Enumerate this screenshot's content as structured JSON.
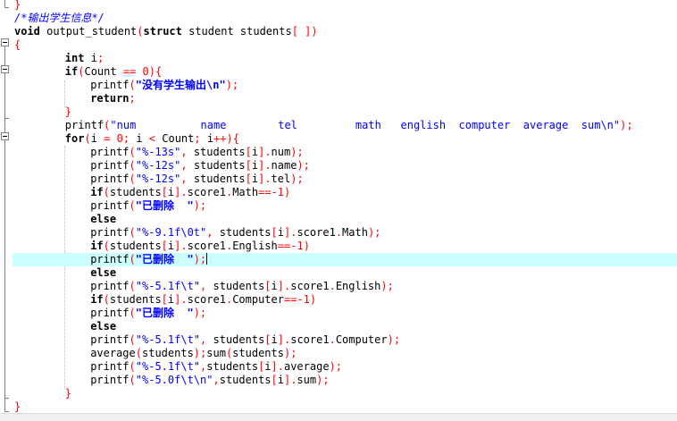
{
  "editor": {
    "colors": {
      "keyword": "#000000",
      "string": "#0000ff",
      "comment": "#0000ff",
      "operator": "#ff0000",
      "current_line": "#ccffff",
      "fold_marker": "#808080"
    },
    "current_line_index": 19,
    "lines": [
      {
        "indent": 0,
        "tokens": [
          {
            "t": "}",
            "k": "op"
          }
        ]
      },
      {
        "indent": 0,
        "tokens": [
          {
            "t": "/*输出学生信息*/",
            "k": "cmt"
          }
        ]
      },
      {
        "indent": 0,
        "tokens": [
          {
            "t": "void",
            "k": "kw"
          },
          {
            "t": " output_student",
            "k": "id"
          },
          {
            "t": "(",
            "k": "op"
          },
          {
            "t": "struct",
            "k": "kw"
          },
          {
            "t": " student students",
            "k": "id"
          },
          {
            "t": "[ ])",
            "k": "op"
          }
        ]
      },
      {
        "indent": 0,
        "tokens": [
          {
            "t": "{",
            "k": "op"
          }
        ]
      },
      {
        "indent": 4,
        "tokens": [
          {
            "t": "int",
            "k": "kw"
          },
          {
            "t": " i",
            "k": "id"
          },
          {
            "t": ";",
            "k": "op"
          }
        ]
      },
      {
        "indent": 4,
        "tokens": [
          {
            "t": "if",
            "k": "kw"
          },
          {
            "t": "(",
            "k": "op"
          },
          {
            "t": "Count ",
            "k": "id"
          },
          {
            "t": "==",
            "k": "op"
          },
          {
            "t": " ",
            "k": "id"
          },
          {
            "t": "0",
            "k": "num"
          },
          {
            "t": "){",
            "k": "op"
          }
        ]
      },
      {
        "indent": 6,
        "tokens": [
          {
            "t": "printf",
            "k": "id"
          },
          {
            "t": "(",
            "k": "op"
          },
          {
            "t": "\"没有学生输出\\n\"",
            "k": "strcn"
          },
          {
            "t": ");",
            "k": "op"
          }
        ]
      },
      {
        "indent": 6,
        "tokens": [
          {
            "t": "return",
            "k": "kw"
          },
          {
            "t": ";",
            "k": "op"
          }
        ]
      },
      {
        "indent": 4,
        "tokens": [
          {
            "t": "}",
            "k": "op"
          }
        ]
      },
      {
        "indent": 4,
        "tokens": [
          {
            "t": "printf",
            "k": "id"
          },
          {
            "t": "(",
            "k": "op"
          },
          {
            "t": "\"num          name        tel         math   english  computer  average  sum\\n\"",
            "k": "str"
          },
          {
            "t": ");",
            "k": "op"
          }
        ]
      },
      {
        "indent": 4,
        "tokens": [
          {
            "t": "for",
            "k": "kw"
          },
          {
            "t": "(",
            "k": "op"
          },
          {
            "t": "i ",
            "k": "id"
          },
          {
            "t": "=",
            "k": "op"
          },
          {
            "t": " ",
            "k": "id"
          },
          {
            "t": "0",
            "k": "num"
          },
          {
            "t": ";",
            "k": "op"
          },
          {
            "t": " i ",
            "k": "id"
          },
          {
            "t": "<",
            "k": "op"
          },
          {
            "t": " Count",
            "k": "id"
          },
          {
            "t": ";",
            "k": "op"
          },
          {
            "t": " i",
            "k": "id"
          },
          {
            "t": "++){",
            "k": "op"
          }
        ]
      },
      {
        "indent": 6,
        "tokens": [
          {
            "t": "printf",
            "k": "id"
          },
          {
            "t": "(",
            "k": "op"
          },
          {
            "t": "\"%-13s\"",
            "k": "str"
          },
          {
            "t": ",",
            "k": "op"
          },
          {
            "t": " students",
            "k": "id"
          },
          {
            "t": "[",
            "k": "op"
          },
          {
            "t": "i",
            "k": "id"
          },
          {
            "t": "].",
            "k": "op"
          },
          {
            "t": "num",
            "k": "id"
          },
          {
            "t": ");",
            "k": "op"
          }
        ]
      },
      {
        "indent": 6,
        "tokens": [
          {
            "t": "printf",
            "k": "id"
          },
          {
            "t": "(",
            "k": "op"
          },
          {
            "t": "\"%-12s\"",
            "k": "str"
          },
          {
            "t": ",",
            "k": "op"
          },
          {
            "t": " students",
            "k": "id"
          },
          {
            "t": "[",
            "k": "op"
          },
          {
            "t": "i",
            "k": "id"
          },
          {
            "t": "].",
            "k": "op"
          },
          {
            "t": "name",
            "k": "id"
          },
          {
            "t": ");",
            "k": "op"
          }
        ]
      },
      {
        "indent": 6,
        "tokens": [
          {
            "t": "printf",
            "k": "id"
          },
          {
            "t": "(",
            "k": "op"
          },
          {
            "t": "\"%-12s\"",
            "k": "str"
          },
          {
            "t": ",",
            "k": "op"
          },
          {
            "t": " students",
            "k": "id"
          },
          {
            "t": "[",
            "k": "op"
          },
          {
            "t": "i",
            "k": "id"
          },
          {
            "t": "].",
            "k": "op"
          },
          {
            "t": "tel",
            "k": "id"
          },
          {
            "t": ");",
            "k": "op"
          }
        ]
      },
      {
        "indent": 6,
        "tokens": [
          {
            "t": "if",
            "k": "kw"
          },
          {
            "t": "(",
            "k": "op"
          },
          {
            "t": "students",
            "k": "id"
          },
          {
            "t": "[",
            "k": "op"
          },
          {
            "t": "i",
            "k": "id"
          },
          {
            "t": "].",
            "k": "op"
          },
          {
            "t": "score1",
            "k": "id"
          },
          {
            "t": ".",
            "k": "op"
          },
          {
            "t": "Math",
            "k": "id"
          },
          {
            "t": "==-",
            "k": "op"
          },
          {
            "t": "1",
            "k": "num"
          },
          {
            "t": ")",
            "k": "op"
          }
        ]
      },
      {
        "indent": 6,
        "tokens": [
          {
            "t": "printf",
            "k": "id"
          },
          {
            "t": "(",
            "k": "op"
          },
          {
            "t": "\"已删除  \"",
            "k": "strcn"
          },
          {
            "t": ");",
            "k": "op"
          }
        ]
      },
      {
        "indent": 6,
        "tokens": [
          {
            "t": "else",
            "k": "kw"
          }
        ]
      },
      {
        "indent": 6,
        "tokens": [
          {
            "t": "printf",
            "k": "id"
          },
          {
            "t": "(",
            "k": "op"
          },
          {
            "t": "\"%-9.1f\\0t\"",
            "k": "str"
          },
          {
            "t": ",",
            "k": "op"
          },
          {
            "t": " students",
            "k": "id"
          },
          {
            "t": "[",
            "k": "op"
          },
          {
            "t": "i",
            "k": "id"
          },
          {
            "t": "].",
            "k": "op"
          },
          {
            "t": "score1",
            "k": "id"
          },
          {
            "t": ".",
            "k": "op"
          },
          {
            "t": "Math",
            "k": "id"
          },
          {
            "t": ");",
            "k": "op"
          }
        ]
      },
      {
        "indent": 6,
        "tokens": [
          {
            "t": "if",
            "k": "kw"
          },
          {
            "t": "(",
            "k": "op"
          },
          {
            "t": "students",
            "k": "id"
          },
          {
            "t": "[",
            "k": "op"
          },
          {
            "t": "i",
            "k": "id"
          },
          {
            "t": "].",
            "k": "op"
          },
          {
            "t": "score1",
            "k": "id"
          },
          {
            "t": ".",
            "k": "op"
          },
          {
            "t": "English",
            "k": "id"
          },
          {
            "t": "==-",
            "k": "op"
          },
          {
            "t": "1",
            "k": "num"
          },
          {
            "t": ")",
            "k": "op"
          }
        ]
      },
      {
        "indent": 6,
        "tokens": [
          {
            "t": "printf",
            "k": "id"
          },
          {
            "t": "(",
            "k": "op"
          },
          {
            "t": "\"已删除  \"",
            "k": "strcn"
          },
          {
            "t": ");",
            "k": "op"
          }
        ],
        "caret": true
      },
      {
        "indent": 6,
        "tokens": [
          {
            "t": "else",
            "k": "kw"
          }
        ]
      },
      {
        "indent": 6,
        "tokens": [
          {
            "t": "printf",
            "k": "id"
          },
          {
            "t": "(",
            "k": "op"
          },
          {
            "t": "\"%-5.1f\\t\"",
            "k": "str"
          },
          {
            "t": ",",
            "k": "op"
          },
          {
            "t": " students",
            "k": "id"
          },
          {
            "t": "[",
            "k": "op"
          },
          {
            "t": "i",
            "k": "id"
          },
          {
            "t": "].",
            "k": "op"
          },
          {
            "t": "score1",
            "k": "id"
          },
          {
            "t": ".",
            "k": "op"
          },
          {
            "t": "English",
            "k": "id"
          },
          {
            "t": ");",
            "k": "op"
          }
        ]
      },
      {
        "indent": 6,
        "tokens": [
          {
            "t": "if",
            "k": "kw"
          },
          {
            "t": "(",
            "k": "op"
          },
          {
            "t": "students",
            "k": "id"
          },
          {
            "t": "[",
            "k": "op"
          },
          {
            "t": "i",
            "k": "id"
          },
          {
            "t": "].",
            "k": "op"
          },
          {
            "t": "score1",
            "k": "id"
          },
          {
            "t": ".",
            "k": "op"
          },
          {
            "t": "Computer",
            "k": "id"
          },
          {
            "t": "==-",
            "k": "op"
          },
          {
            "t": "1",
            "k": "num"
          },
          {
            "t": ")",
            "k": "op"
          }
        ]
      },
      {
        "indent": 6,
        "tokens": [
          {
            "t": "printf",
            "k": "id"
          },
          {
            "t": "(",
            "k": "op"
          },
          {
            "t": "\"已删除  \"",
            "k": "strcn"
          },
          {
            "t": ");",
            "k": "op"
          }
        ]
      },
      {
        "indent": 6,
        "tokens": [
          {
            "t": "else",
            "k": "kw"
          }
        ]
      },
      {
        "indent": 6,
        "tokens": [
          {
            "t": "printf",
            "k": "id"
          },
          {
            "t": "(",
            "k": "op"
          },
          {
            "t": "\"%-5.1f\\t\"",
            "k": "str"
          },
          {
            "t": ",",
            "k": "op"
          },
          {
            "t": " students",
            "k": "id"
          },
          {
            "t": "[",
            "k": "op"
          },
          {
            "t": "i",
            "k": "id"
          },
          {
            "t": "].",
            "k": "op"
          },
          {
            "t": "score1",
            "k": "id"
          },
          {
            "t": ".",
            "k": "op"
          },
          {
            "t": "Computer",
            "k": "id"
          },
          {
            "t": ");",
            "k": "op"
          }
        ]
      },
      {
        "indent": 6,
        "tokens": [
          {
            "t": "average",
            "k": "id"
          },
          {
            "t": "(",
            "k": "op"
          },
          {
            "t": "students",
            "k": "id"
          },
          {
            "t": ");",
            "k": "op"
          },
          {
            "t": "sum",
            "k": "id"
          },
          {
            "t": "(",
            "k": "op"
          },
          {
            "t": "students",
            "k": "id"
          },
          {
            "t": ");",
            "k": "op"
          }
        ]
      },
      {
        "indent": 6,
        "tokens": [
          {
            "t": "printf",
            "k": "id"
          },
          {
            "t": "(",
            "k": "op"
          },
          {
            "t": "\"%-5.1f\\t\"",
            "k": "str"
          },
          {
            "t": ",",
            "k": "op"
          },
          {
            "t": "students",
            "k": "id"
          },
          {
            "t": "[",
            "k": "op"
          },
          {
            "t": "i",
            "k": "id"
          },
          {
            "t": "].",
            "k": "op"
          },
          {
            "t": "average",
            "k": "id"
          },
          {
            "t": ");",
            "k": "op"
          }
        ]
      },
      {
        "indent": 6,
        "tokens": [
          {
            "t": "printf",
            "k": "id"
          },
          {
            "t": "(",
            "k": "op"
          },
          {
            "t": "\"%-5.0f\\t\\n\"",
            "k": "str"
          },
          {
            "t": ",",
            "k": "op"
          },
          {
            "t": "students",
            "k": "id"
          },
          {
            "t": "[",
            "k": "op"
          },
          {
            "t": "i",
            "k": "id"
          },
          {
            "t": "].",
            "k": "op"
          },
          {
            "t": "sum",
            "k": "id"
          },
          {
            "t": ");",
            "k": "op"
          }
        ]
      },
      {
        "indent": 4,
        "tokens": [
          {
            "t": "}",
            "k": "op"
          }
        ]
      },
      {
        "indent": 0,
        "tokens": [
          {
            "t": "}",
            "k": "op"
          }
        ]
      }
    ]
  }
}
